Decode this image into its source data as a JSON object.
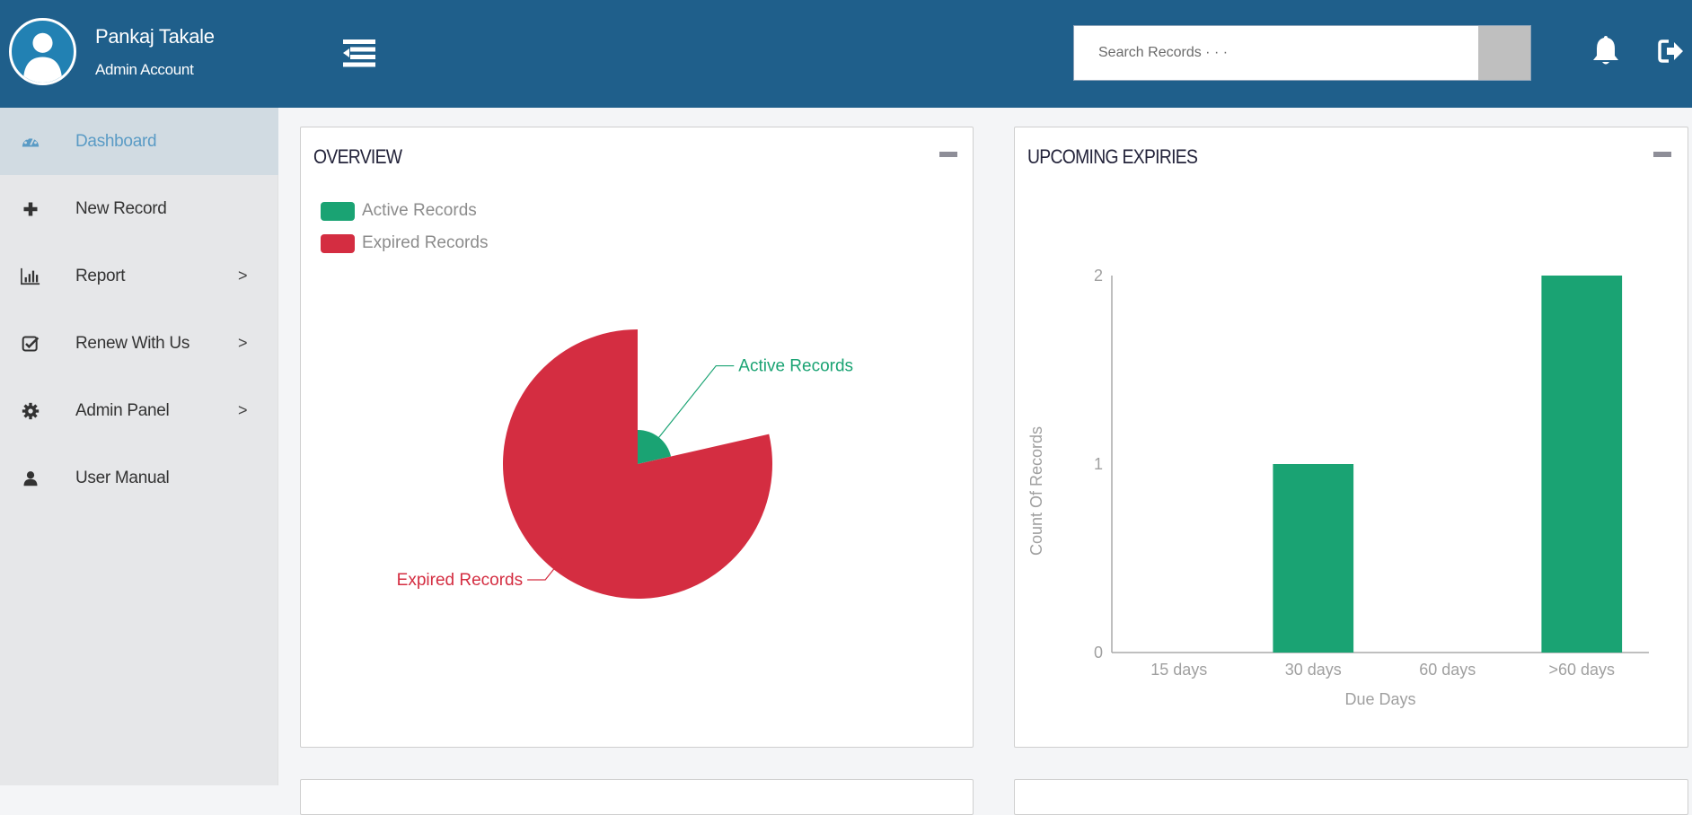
{
  "header": {
    "user_name": "Pankaj Takale",
    "user_role": "Admin Account",
    "search_placeholder": "Search Records · · ·",
    "icons": {
      "avatar": "user-avatar-icon",
      "menu_toggle": "indent-menu-icon",
      "notifications": "bell-icon",
      "logout": "sign-out-icon"
    }
  },
  "sidebar": {
    "items": [
      {
        "label": "Dashboard",
        "icon": "dashboard-gauge-icon",
        "active": true,
        "has_submenu": false
      },
      {
        "label": "New Record",
        "icon": "plus-icon",
        "active": false,
        "has_submenu": false
      },
      {
        "label": "Report",
        "icon": "bar-chart-icon",
        "active": false,
        "has_submenu": true
      },
      {
        "label": "Renew With Us",
        "icon": "check-square-icon",
        "active": false,
        "has_submenu": true
      },
      {
        "label": "Admin Panel",
        "icon": "gear-icon",
        "active": false,
        "has_submenu": true
      },
      {
        "label": "User Manual",
        "icon": "user-icon",
        "active": false,
        "has_submenu": false
      }
    ],
    "chevron": ">"
  },
  "colors": {
    "header_bg": "#1f5f8b",
    "active": "#1aa373",
    "expired": "#d42d41",
    "sidebar_active_text": "#5a9bc5"
  },
  "chart_data": [
    {
      "type": "pie",
      "variant": "rose-radius",
      "title": "OVERVIEW",
      "legend": [
        "Active Records",
        "Expired Records"
      ],
      "legend_position": "top-left",
      "categories": [
        "Active Records",
        "Expired Records"
      ],
      "values": [
        3,
        11
      ],
      "colors": [
        "#1aa373",
        "#d42d41"
      ],
      "labels": [
        "Active Records",
        "Expired Records"
      ]
    },
    {
      "type": "bar",
      "title": "UPCOMING EXPIRIES",
      "categories": [
        "15 days",
        "30 days",
        "60 days",
        ">60 days"
      ],
      "values": [
        0,
        1,
        0,
        2
      ],
      "xlabel": "Due Days",
      "ylabel": "Count Of Records",
      "ylim": [
        0,
        2
      ],
      "yticks": [
        "0",
        "1",
        "2"
      ],
      "grid": false,
      "color": "#1aa373"
    }
  ]
}
